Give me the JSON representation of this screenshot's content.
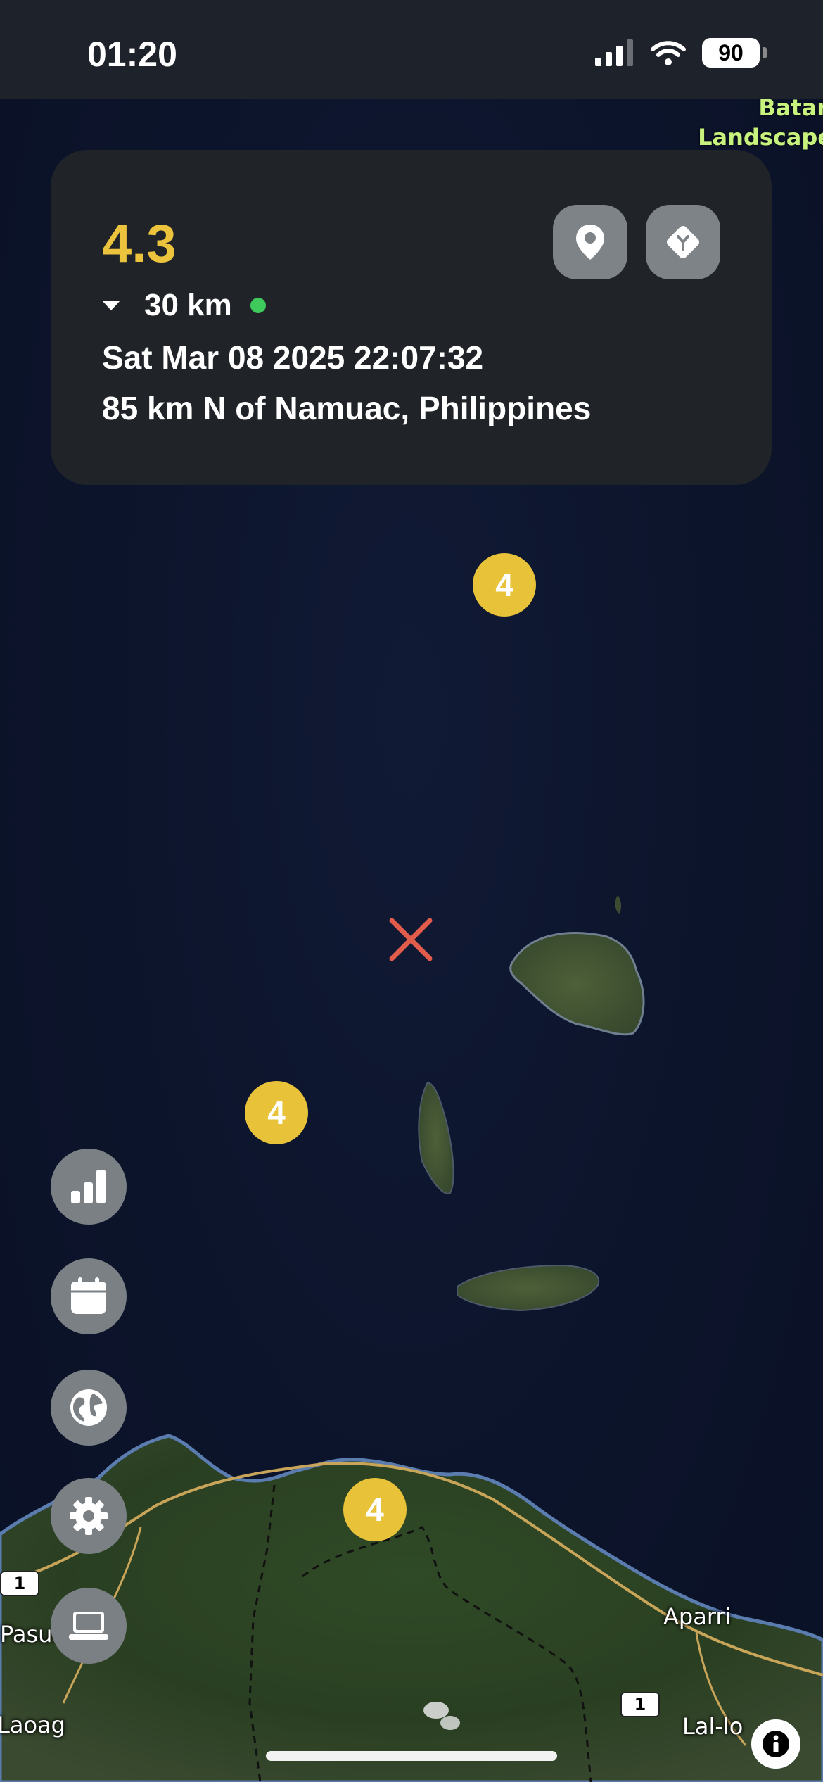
{
  "status_bar": {
    "time": "01:20",
    "battery": "90"
  },
  "quake": {
    "magnitude": "4.3",
    "depth": "30 km",
    "datetime": "Sat Mar 08 2025 22:07:32",
    "location": "85 km N of Namuac, Philippines",
    "magnitude_color": "#ecc33c"
  },
  "map": {
    "corner_label_line1": "Batan",
    "corner_label_line2": "Landscape",
    "places": {
      "aparri": "Aparri",
      "laoag": "Laoag",
      "lal_lo": "Lal-lo",
      "pasuquin": "Pasuq"
    },
    "road_shields": [
      "1",
      "1"
    ],
    "clusters": [
      "4",
      "4",
      "4"
    ],
    "cluster_color": "#e8c33a"
  },
  "icons": {
    "location": "location-pin-icon",
    "directions": "directions-icon",
    "stats": "bar-chart-icon",
    "calendar": "calendar-icon",
    "globe": "globe-icon",
    "settings": "gear-icon",
    "laptop": "laptop-icon",
    "info": "info-icon"
  }
}
